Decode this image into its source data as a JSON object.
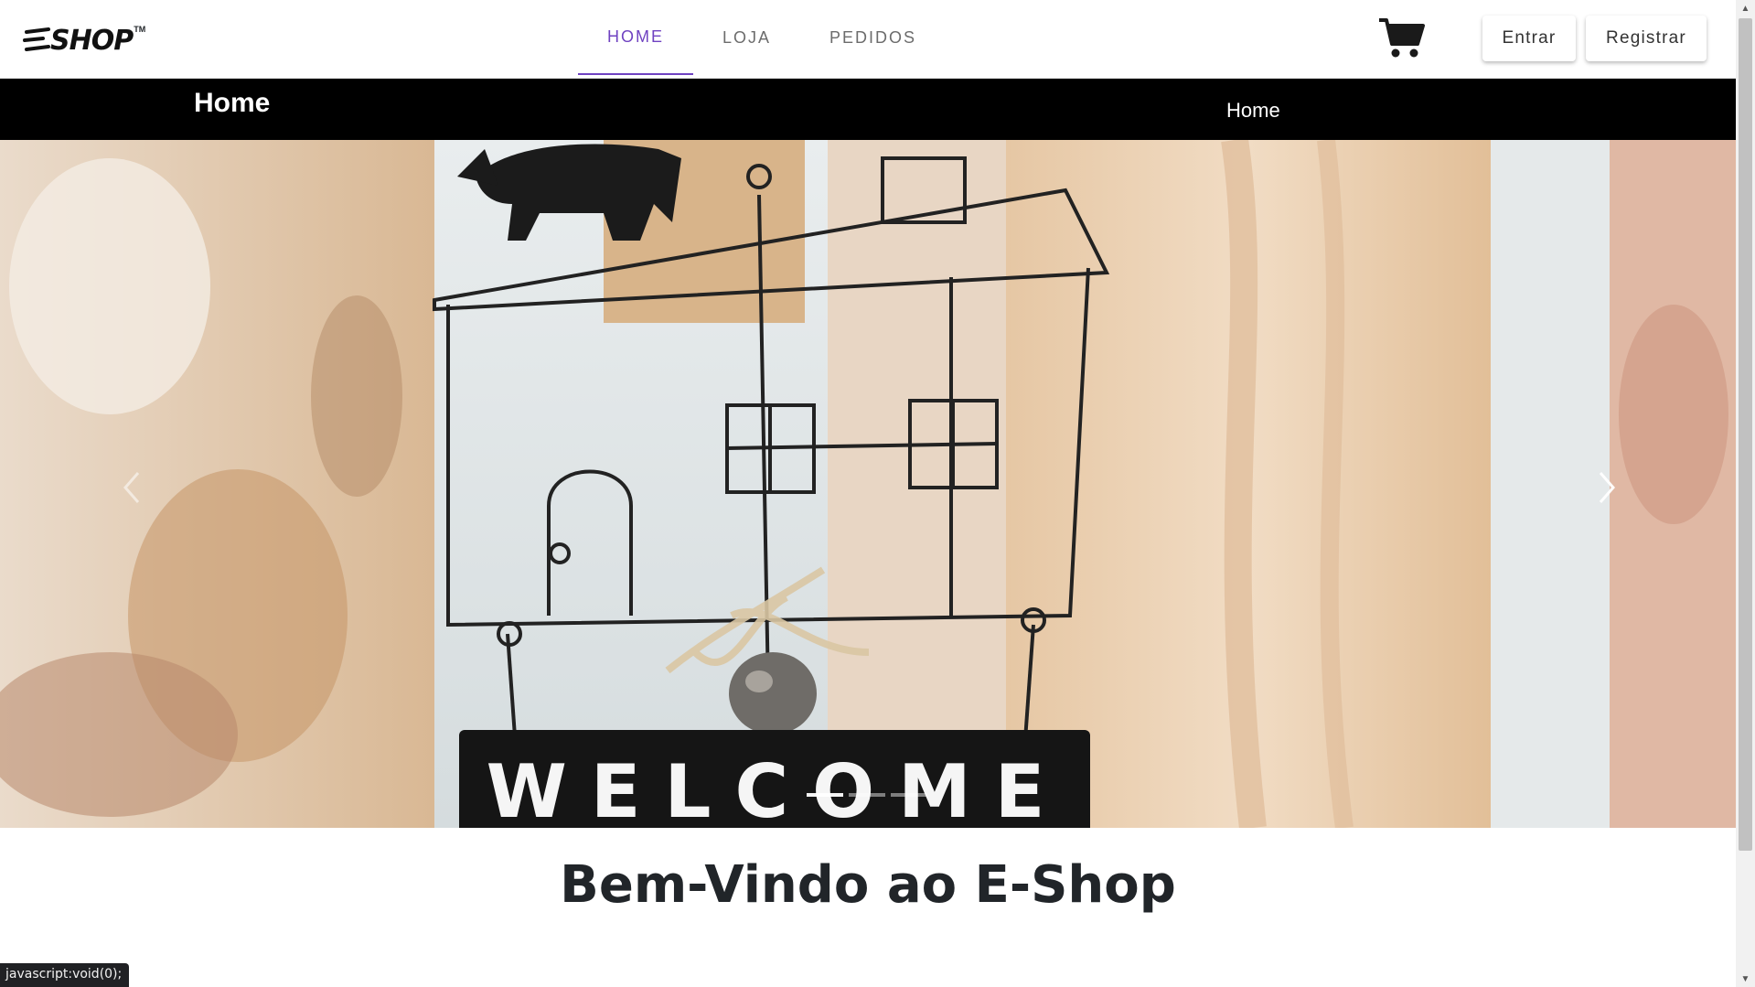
{
  "brand": {
    "logo_text": "SHOP",
    "logo_tm": "TM"
  },
  "nav": {
    "items": [
      {
        "label": "HOME",
        "active": true
      },
      {
        "label": "LOJA",
        "active": false
      },
      {
        "label": "PEDIDOS",
        "active": false
      }
    ],
    "accent_color": "#6f42c1"
  },
  "header_actions": {
    "cart_icon": "shopping-cart-icon",
    "login_label": "Entrar",
    "register_label": "Registrar"
  },
  "title_bar": {
    "page_title": "Home",
    "breadcrumb": "Home"
  },
  "carousel": {
    "slide_caption_visible": "WELCOME",
    "active_index": 0,
    "slide_count": 3,
    "prev_icon": "chevron-left-icon",
    "next_icon": "chevron-right-icon"
  },
  "welcome": {
    "heading": "Bem-Vindo ao E-Shop"
  },
  "status_bar": {
    "text": "javascript:void(0);"
  }
}
